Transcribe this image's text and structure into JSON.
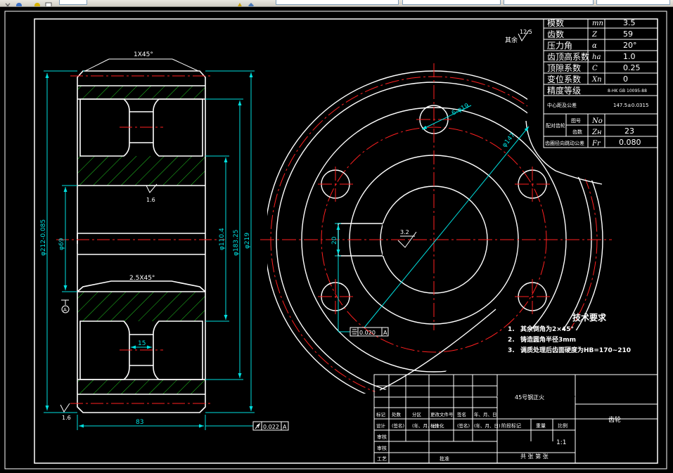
{
  "toolbar": {
    "field_1": "",
    "field_2": "",
    "field_3": "",
    "field_4": "",
    "field_5": ""
  },
  "drawing": {
    "section": {
      "chamfer_top": "1X45°",
      "chamfer_mid": "2.5X45°",
      "width_dim": "83",
      "hub_width_dim": "15",
      "dia_219": "φ219",
      "dia_183": "φ183.25",
      "dia_110": "φ110.4",
      "dia_69": "φ69",
      "dia_212": "φ212-0.085",
      "rough_1": "1.6",
      "rough_2": "1.6",
      "datum_a": "A",
      "runout_tol": "0.022",
      "runout_datum": "A"
    },
    "front": {
      "hole_callout": "6-φ19",
      "pcd": "φ147",
      "keyway_depth": "20",
      "key_rough": "3.2",
      "sym_tol": "0.020",
      "sym_datum": "A"
    },
    "roughness_note": {
      "prefix": "其余",
      "value": "12.5"
    },
    "tech_req": {
      "title": "技术要求",
      "items": [
        {
          "num": "1.",
          "text": "其余倒角为2×45°"
        },
        {
          "num": "2.",
          "text": "铸造圆角半径3mm"
        },
        {
          "num": "3.",
          "text": "调质处理后齿面硬度为HB=170~210"
        }
      ]
    },
    "params": [
      {
        "label": "模数",
        "sym": "mn",
        "value": "3.5"
      },
      {
        "label": "齿数",
        "sym": "Z",
        "value": "59"
      },
      {
        "label": "压力角",
        "sym": "α",
        "value": "20°"
      },
      {
        "label": "齿顶高系数",
        "sym": "ha",
        "value": "1.0"
      },
      {
        "label": "顶隙系数",
        "sym": "C",
        "value": "0.25"
      },
      {
        "label": "变位系数",
        "sym": "Xn",
        "value": "0"
      },
      {
        "label": "精度等级",
        "sym": "",
        "value": "8-HK GB 10095-88"
      }
    ],
    "params_extra": {
      "center_label": "中心距及公差",
      "center_value": "147.5±0.0315",
      "mating_label": "配对齿轮",
      "fig_no_label": "图号",
      "fig_no_sym": "No",
      "teeth_label": "齿数",
      "teeth_sym": "Zн",
      "teeth_value": "23",
      "runout_label": "齿圈径向跳动公差",
      "runout_sym": "Fr",
      "runout_value": "0.080"
    },
    "title_block": {
      "material": "45号钢正火",
      "part_name": "齿轮",
      "scale": "1:1",
      "sheets": "共 张 第 张",
      "headers": [
        "标记",
        "处数",
        "分区",
        "更改文件号",
        "签名",
        "年、月、日"
      ],
      "row_design": [
        "设计",
        "(签名)",
        "(年、月、日)",
        "标准化",
        "(签名)",
        "(年、月、日)"
      ],
      "stage_label": "阶段标记",
      "weight_label": "重量",
      "scale_label": "比例",
      "row_check": "审核",
      "row_process": "工艺",
      "row_approve": "批准",
      "row_blank": "审核"
    }
  }
}
